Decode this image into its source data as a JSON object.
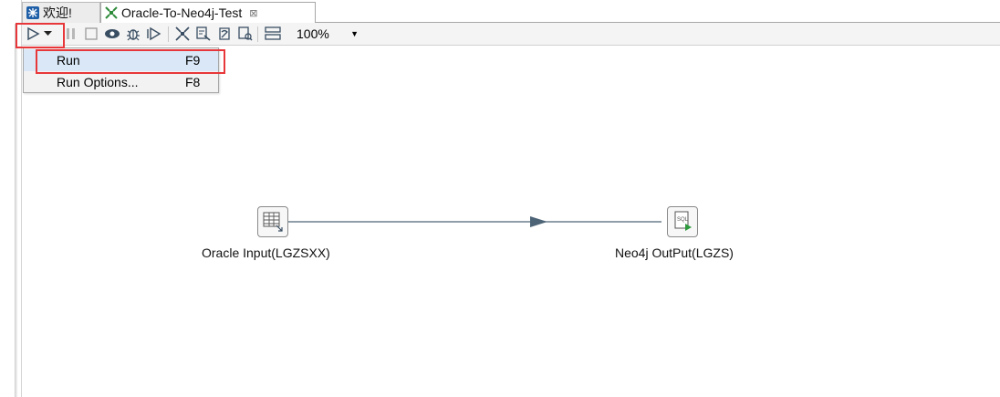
{
  "tabs": [
    {
      "label": "欢迎!",
      "icon": "welcome-icon"
    },
    {
      "label": "Oracle-To-Neo4j-Test",
      "icon": "transformation-icon",
      "close": "⊠"
    }
  ],
  "toolbar": {
    "zoom_value": "100%",
    "buttons": [
      "run-icon",
      "run-dropdown-icon",
      "pause-icon",
      "stop-icon",
      "preview-icon",
      "debug-icon",
      "replay-icon",
      "verify-icon",
      "impact-icon",
      "sql-icon",
      "explore-db-icon",
      "layout-icon"
    ]
  },
  "run_menu": {
    "items": [
      {
        "label": "Run",
        "shortcut": "F9"
      },
      {
        "label": "Run Options...",
        "shortcut": "F8"
      }
    ]
  },
  "canvas": {
    "steps": [
      {
        "label": "Oracle Input(LGZSXX)",
        "icon": "table-input-icon"
      },
      {
        "label": "Neo4j OutPut(LGZS)",
        "icon": "sql-output-icon"
      }
    ],
    "hop_color": "#4d6477"
  }
}
